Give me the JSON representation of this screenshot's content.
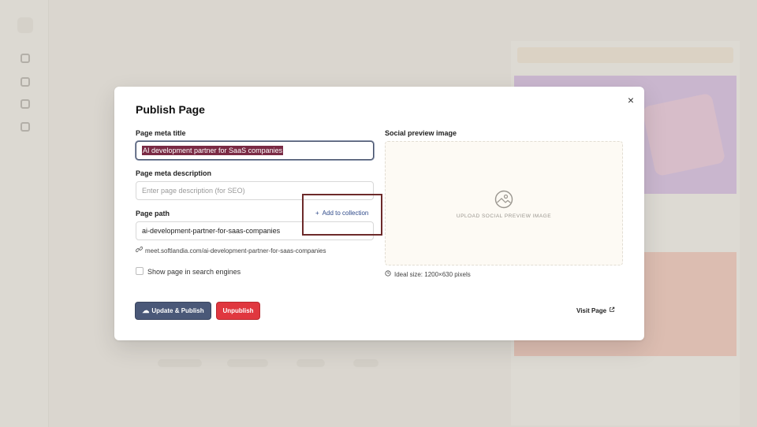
{
  "modal": {
    "title": "Publish Page",
    "meta_title": {
      "label": "Page meta title",
      "value": "AI development partner for SaaS companies"
    },
    "meta_description": {
      "label": "Page meta description",
      "placeholder": "Enter page description (for SEO)"
    },
    "page_path": {
      "label": "Page path",
      "value": "ai-development-partner-for-saas-companies",
      "add_collection_label": "Add to collection",
      "full_url": "meet.softlandia.com/ai-development-partner-for-saas-companies"
    },
    "search_engines_label": "Show page in search engines",
    "social_preview": {
      "label": "Social preview image",
      "upload_text": "UPLOAD SOCIAL PREVIEW IMAGE",
      "ideal_size": "Ideal size: 1200×630 pixels"
    },
    "buttons": {
      "update_publish": "Update & Publish",
      "unpublish": "Unpublish",
      "visit_page": "Visit Page"
    }
  },
  "colors": {
    "primary_button": "#4a5878",
    "danger_button": "#e0373f",
    "selection_highlight": "#7a2a44",
    "callout_border": "#6d2a2a",
    "link_blue": "#2f4a8a"
  },
  "icons": [
    "close-icon",
    "plus-icon",
    "link-icon",
    "cloud-upload-icon",
    "external-link-icon",
    "image-placeholder-icon",
    "clock-icon"
  ]
}
